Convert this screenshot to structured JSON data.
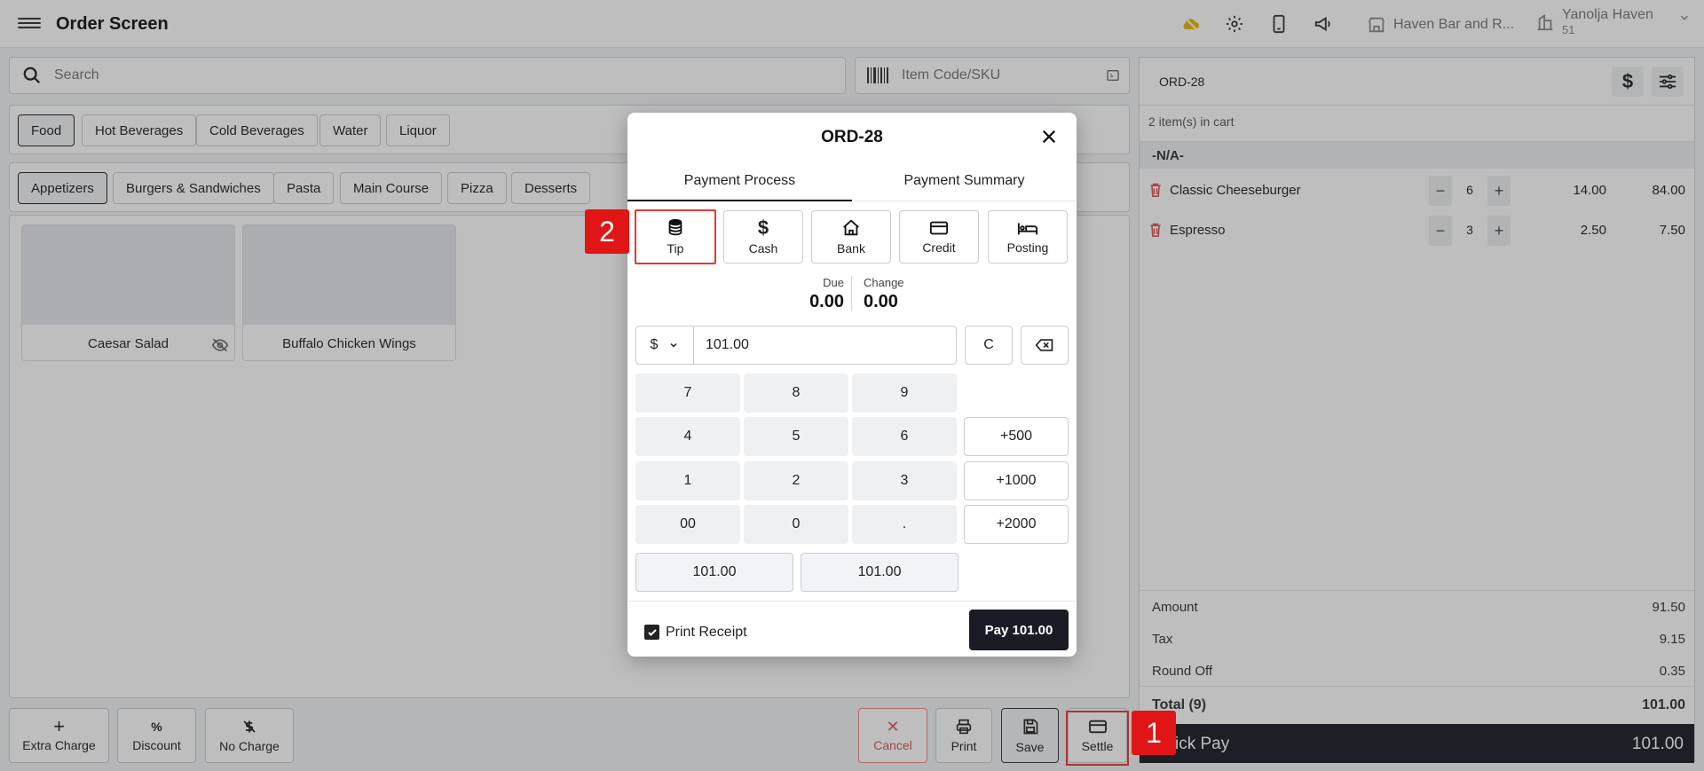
{
  "header": {
    "title": "Order Screen",
    "store": "Haven Bar and R...",
    "user_name": "Yanolja Haven",
    "user_sub": "51"
  },
  "search": {
    "placeholder": "Search"
  },
  "sku": {
    "placeholder": "Item Code/SKU"
  },
  "categories": [
    "Food",
    "Hot Beverages",
    "Cold Beverages",
    "Water",
    "Liquor"
  ],
  "subcategories": [
    "Appetizers",
    "Burgers & Sandwiches",
    "Pasta",
    "Main Course",
    "Pizza",
    "Desserts"
  ],
  "products": [
    "Caesar Salad",
    "Buffalo Chicken Wings"
  ],
  "actions": {
    "extra_charge": "Extra Charge",
    "discount": "Discount",
    "no_charge": "No Charge",
    "cancel": "Cancel",
    "print": "Print",
    "save": "Save",
    "settle": "Settle"
  },
  "cart": {
    "order_id": "ORD-28",
    "count": "2 item(s) in cart",
    "group": "-N/A-",
    "items": [
      {
        "name": "Classic Cheeseburger",
        "qty": "6",
        "price": "14.00",
        "total": "84.00"
      },
      {
        "name": "Espresso",
        "qty": "3",
        "price": "2.50",
        "total": "7.50"
      }
    ],
    "amount_label": "Amount",
    "amount": "91.50",
    "tax_label": "Tax",
    "tax": "9.15",
    "roundoff_label": "Round Off",
    "roundoff": "0.35",
    "total_label": "Total (9)",
    "total": "101.00",
    "quick_pay_label": "ick Pay",
    "quick_pay_value": "101.00"
  },
  "modal": {
    "title": "ORD-28",
    "tabs": [
      "Payment Process",
      "Payment Summary"
    ],
    "methods": [
      {
        "label": "Tip",
        "icon": "coins-icon"
      },
      {
        "label": "Cash",
        "icon": "dollar-icon"
      },
      {
        "label": "Bank",
        "icon": "bank-icon"
      },
      {
        "label": "Credit",
        "icon": "credit-card-icon"
      },
      {
        "label": "Posting",
        "icon": "bed-icon"
      }
    ],
    "due_label": "Due",
    "due": "0.00",
    "change_label": "Change",
    "change": "0.00",
    "currency": "$",
    "amount": "101.00",
    "clear": "C",
    "keys": [
      "7",
      "8",
      "9",
      "4",
      "5",
      "6",
      "1",
      "2",
      "3",
      "00",
      "0",
      "."
    ],
    "plus_keys": [
      "+500",
      "+1000",
      "+2000"
    ],
    "presets": [
      "101.00",
      "101.00"
    ],
    "print_receipt": "Print Receipt",
    "pay_button": "Pay 101.00"
  },
  "badges": {
    "one": "1",
    "two": "2"
  },
  "colors": {
    "highlight": "#e53935",
    "dark": "#1b1b26",
    "weather": "#e6b800"
  }
}
